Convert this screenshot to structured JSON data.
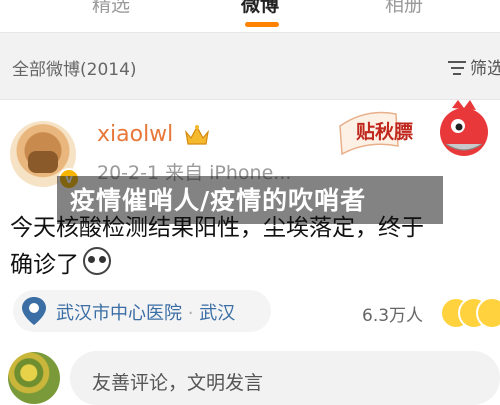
{
  "top_tabs": [
    {
      "label": "精选",
      "active": false
    },
    {
      "label": "微博",
      "active": true
    },
    {
      "label": "相册",
      "active": false
    }
  ],
  "filter_bar": {
    "title": "全部微博(2014)",
    "filter_label": "筛选",
    "filter_icon": "filter-lines-icon"
  },
  "post": {
    "username": "xiaolwl",
    "verified_badge": "v",
    "meta": "20-2-1  来自 iPhone...",
    "sticker_text": "贴秋膘",
    "overlay_text": "疫情催哨人/疫情的吹哨者",
    "content_line1": "今天核酸检测结果阳性，尘埃落定，终于",
    "content_line2": "确诊了",
    "location": {
      "name": "武汉市中心医院",
      "separator": "·",
      "city": "武汉"
    },
    "views": "6.3万人"
  },
  "composer": {
    "placeholder": "友善评论，文明发言"
  },
  "colors": {
    "accent": "#ff8200",
    "username": "#e8783a",
    "location": "#3a6ea5"
  }
}
